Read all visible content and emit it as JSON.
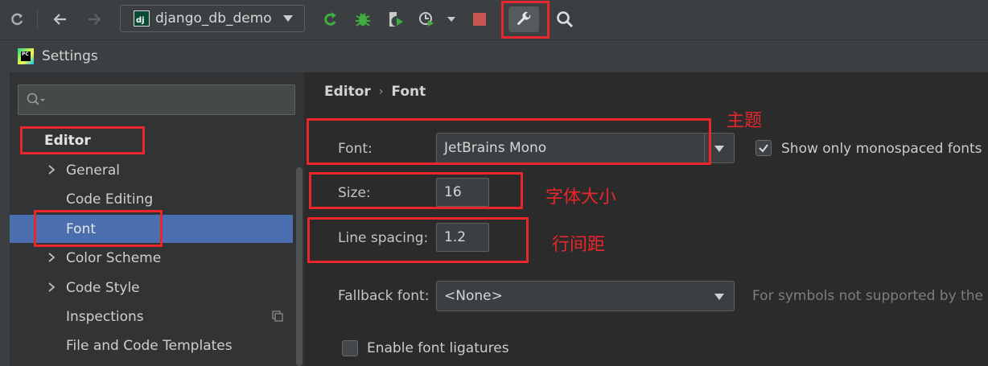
{
  "toolbar": {
    "run_config": "django_db_demo",
    "run_config_icon": "dj"
  },
  "window": {
    "title": "Settings"
  },
  "sidebar": {
    "search_placeholder": "",
    "items": [
      {
        "label": "Editor",
        "expandable": false,
        "selected": false
      },
      {
        "label": "General",
        "expandable": true,
        "selected": false
      },
      {
        "label": "Code Editing",
        "expandable": false,
        "selected": false
      },
      {
        "label": "Font",
        "expandable": false,
        "selected": true
      },
      {
        "label": "Color Scheme",
        "expandable": true,
        "selected": false
      },
      {
        "label": "Code Style",
        "expandable": true,
        "selected": false
      },
      {
        "label": "Inspections",
        "expandable": false,
        "selected": false
      },
      {
        "label": "File and Code Templates",
        "expandable": false,
        "selected": false
      }
    ]
  },
  "content": {
    "breadcrumb": [
      "Editor",
      "Font"
    ],
    "font_label": "Font:",
    "font_value": "JetBrains Mono",
    "monospaced_label": "Show only monospaced fonts",
    "monospaced_checked": true,
    "size_label": "Size:",
    "size_value": "16",
    "line_spacing_label": "Line spacing:",
    "line_spacing_value": "1.2",
    "fallback_label": "Fallback font:",
    "fallback_value": "<None>",
    "fallback_hint": "For symbols not supported by the r",
    "ligatures_label": "Enable font ligatures",
    "ligatures_checked": false
  },
  "annotations": {
    "theme": "主题",
    "font_size": "字体大小",
    "line_spacing": "行间距"
  },
  "colors": {
    "selection": "#4b6eaf",
    "annotation": "#e8262b",
    "run_green": "#3fae3f",
    "stop_red": "#c75450"
  }
}
